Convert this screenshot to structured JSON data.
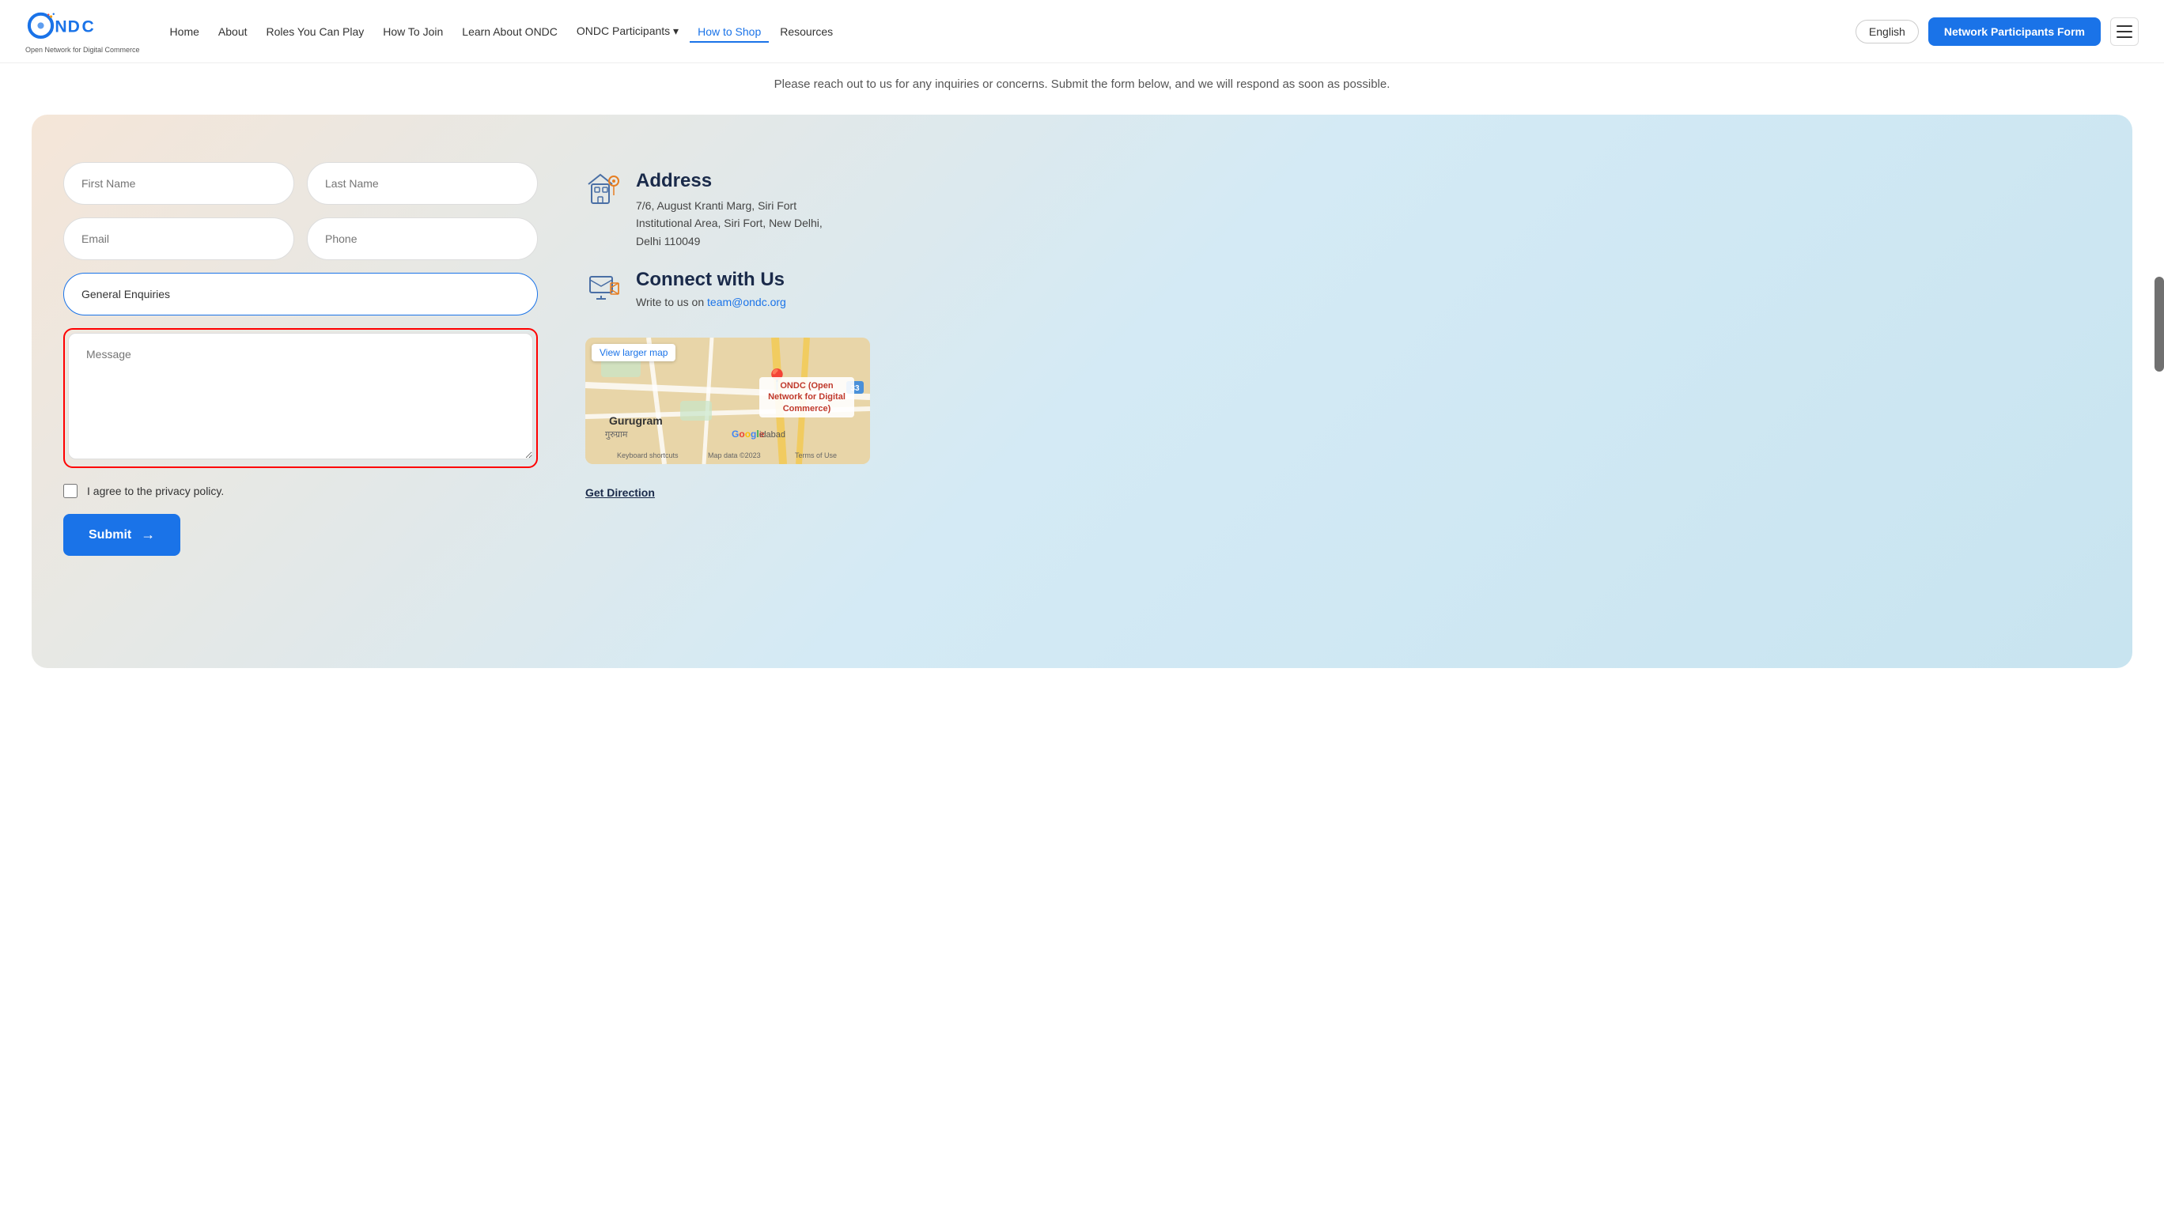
{
  "navbar": {
    "logo_text": "ONDC",
    "logo_tagline": "Open Network for Digital Commerce",
    "links": [
      {
        "label": "Home",
        "id": "home",
        "active": false
      },
      {
        "label": "About",
        "id": "about",
        "active": false
      },
      {
        "label": "Roles You Can Play",
        "id": "roles",
        "active": false
      },
      {
        "label": "How To Join",
        "id": "how-to-join",
        "active": false
      },
      {
        "label": "Learn About ONDC",
        "id": "learn",
        "active": false
      },
      {
        "label": "ONDC Participants ▾",
        "id": "participants",
        "active": false
      },
      {
        "label": "How to Shop",
        "id": "how-to-shop",
        "active": true
      },
      {
        "label": "Resources",
        "id": "resources",
        "active": false
      }
    ],
    "lang_btn": "English",
    "np_btn": "Network Participants Form"
  },
  "page": {
    "subtitle": "Please reach out to us for any inquiries or concerns. Submit the form below, and we will respond as soon as possible."
  },
  "form": {
    "first_name_placeholder": "First Name",
    "last_name_placeholder": "Last Name",
    "email_placeholder": "Email",
    "phone_placeholder": "Phone",
    "enquiry_value": "General Enquiries",
    "message_placeholder": "Message",
    "privacy_label": "I agree to the privacy policy.",
    "submit_label": "Submit"
  },
  "contact": {
    "address_title": "Address",
    "address_line1": "7/6, August Kranti Marg, Siri Fort",
    "address_line2": "Institutional Area, Siri Fort, New Delhi,",
    "address_line3": "Delhi 110049",
    "connect_title": "Connect with Us",
    "connect_prefix": "Write to us on ",
    "connect_email": "team@ondc.org",
    "map_view_larger": "View larger map",
    "map_label": "ONDC (Open Network for Digital Commerce)",
    "map_city": "Gurugram",
    "map_city_dev": "गुरुग्राम",
    "map_brand": "Google",
    "map_caption": "Keyboard shortcuts   Map data ©2023   Terms of Use",
    "map_city2": "idabad",
    "get_direction": "Get Direction"
  }
}
